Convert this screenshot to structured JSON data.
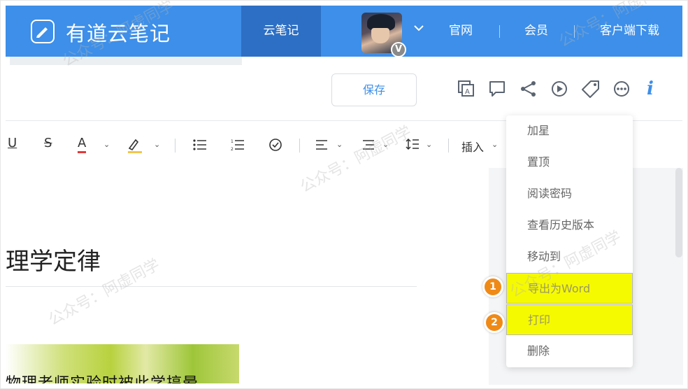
{
  "header": {
    "app_name": "有道云笔记",
    "active_nav": "云笔记",
    "vip_badge": "V",
    "nav_items": [
      "官网",
      "会员",
      "客户端下载"
    ]
  },
  "toolbar": {
    "save_label": "保存",
    "icons": [
      "ocr-icon",
      "comment-icon",
      "share-icon",
      "play-icon",
      "tag-icon",
      "more-icon",
      "info-icon"
    ],
    "info_glyph": "i"
  },
  "format_bar": {
    "underline": "U",
    "strike": "S",
    "font_color": "A",
    "insert_label": "插入"
  },
  "document": {
    "title_fragment": "理学定律",
    "image_caption": "物理老师实验时被此学搞晕"
  },
  "menu": {
    "items": [
      "加星",
      "置顶",
      "阅读密码",
      "查看历史版本",
      "移动到",
      "导出为Word",
      "打印",
      "删除"
    ],
    "highlighted": [
      "导出为Word",
      "打印"
    ],
    "step_badges": [
      "1",
      "2"
    ]
  },
  "watermark": "公众号：阿虚同学",
  "colors": {
    "header_bg": "#3d8fe9",
    "active_nav_bg": "#2d6fc4",
    "highlight": "#f6fa00",
    "badge": "#ef8a17",
    "font_color_bar": "#e23a3a",
    "highlight_pen_bar": "#f3c64b"
  }
}
